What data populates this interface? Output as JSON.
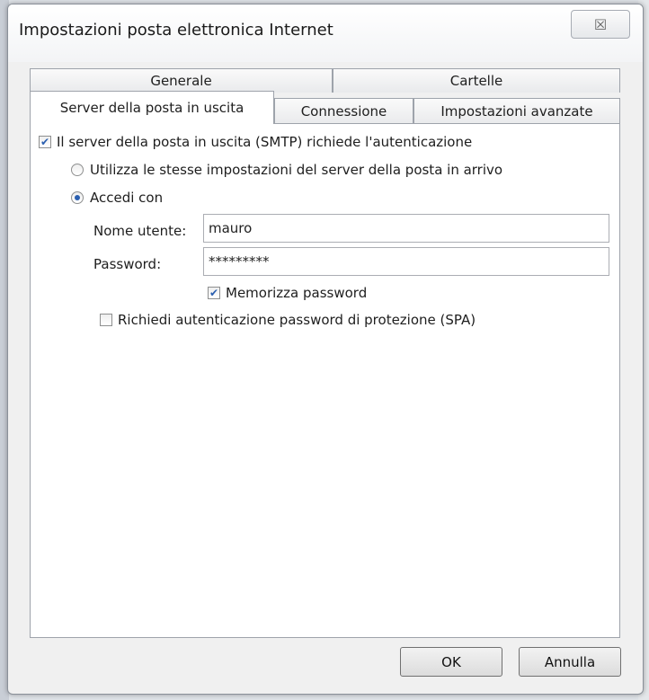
{
  "window": {
    "title": "Impostazioni posta elettronica Internet",
    "close_symbol": "☒"
  },
  "tabs": {
    "back_row": [
      {
        "label": "Generale"
      },
      {
        "label": "Cartelle"
      }
    ],
    "front_row": [
      {
        "label": "Server della posta in uscita",
        "active": true
      },
      {
        "label": "Connessione"
      },
      {
        "label": "Impostazioni avanzate"
      }
    ]
  },
  "form": {
    "smtp_auth": {
      "label": "Il server della posta in uscita (SMTP) richiede l'autenticazione",
      "checked": true
    },
    "radio_same_settings": {
      "label": "Utilizza le stesse impostazioni del server della posta in arrivo",
      "selected": false
    },
    "radio_login_with": {
      "label": "Accedi con",
      "selected": true
    },
    "username": {
      "label": "Nome utente:",
      "value": "mauro"
    },
    "password": {
      "label": "Password:",
      "value": "*********"
    },
    "remember_password": {
      "label": "Memorizza password",
      "checked": true
    },
    "spa": {
      "label": "Richiedi autenticazione password di protezione (SPA)",
      "checked": false
    }
  },
  "buttons": {
    "ok": "OK",
    "cancel": "Annulla"
  },
  "colors": {
    "accent": "#2a5fb0",
    "dialog_bg": "#f0f0f0"
  }
}
